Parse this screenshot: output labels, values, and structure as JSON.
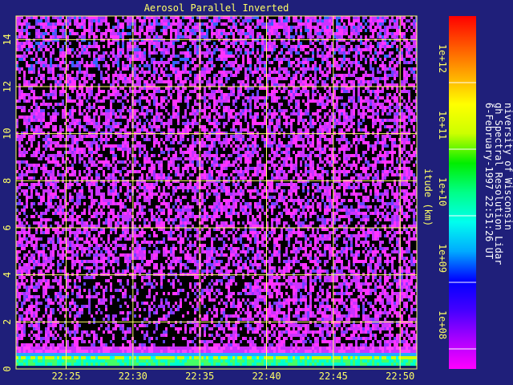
{
  "chart_data": {
    "type": "heatmap",
    "title": "Aerosol Parallel Inverted",
    "xlabel": "",
    "ylabel": "itude (km)",
    "x_ticks": [
      "22:25",
      "22:30",
      "22:35",
      "22:40",
      "22:45",
      "22:50"
    ],
    "y_ticks": [
      "0",
      "2",
      "4",
      "6",
      "8",
      "10",
      "12",
      "14"
    ],
    "xlim": [
      "22:21:15",
      "22:51:15"
    ],
    "ylim": [
      0,
      15
    ],
    "grid": true,
    "colorbar": {
      "scale": "log",
      "range": [
        50000000.0,
        10000000000000.0
      ],
      "ticks": [
        "1e+08",
        "1e+09",
        "1e+10",
        "1e+11",
        "1e+12"
      ],
      "colors": [
        "#ff00ff",
        "#aa00ff",
        "#4400ff",
        "#0000ff",
        "#00aaff",
        "#00ffee",
        "#00ff88",
        "#00ee00",
        "#ccff00",
        "#ffff00",
        "#ffaa00",
        "#ff5500",
        "#ff0000"
      ]
    },
    "annotation_lines": [
      "niversity of Wisconsin",
      "gh Spectral Resolution Lidar",
      "6-February-1997 22:51:26 UT"
    ]
  }
}
